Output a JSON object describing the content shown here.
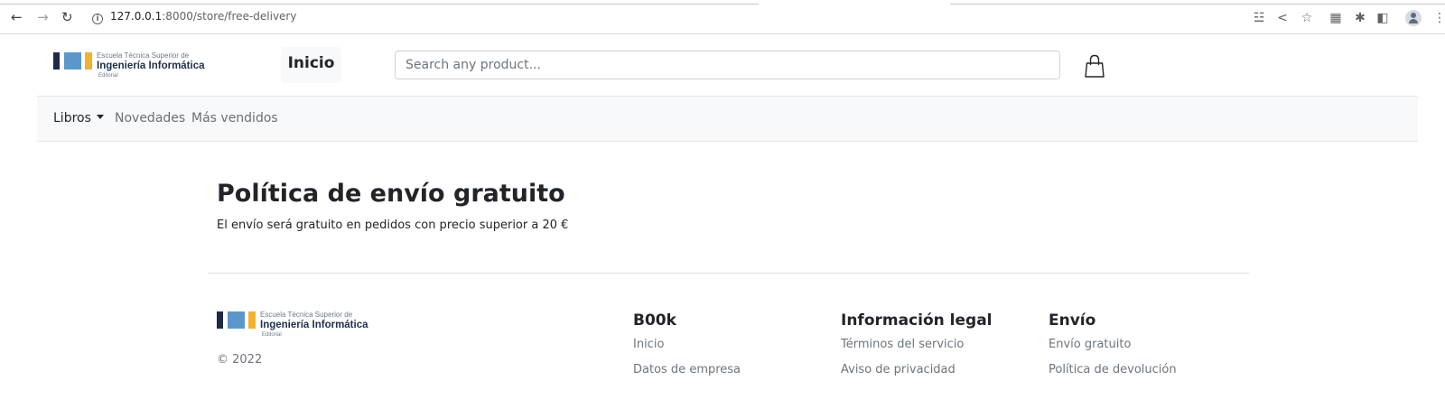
{
  "browser": {
    "url_host": "127.0.0.1",
    "url_path": ":8000/store/free-delivery",
    "info_glyph": "i"
  },
  "logo": {
    "line1": "Escuela Técnica Superior de",
    "line2": "Ingeniería Informática",
    "line3": "Editorial",
    "colors": [
      "#1d2a48",
      "#5a98cc",
      "#f2b12f"
    ]
  },
  "header": {
    "home_label": "Inicio",
    "search_placeholder": "Search any product...",
    "cart_icon": "shopping-bag-icon"
  },
  "navbar": {
    "items": [
      {
        "label": "Libros",
        "dropdown": true
      },
      {
        "label": "Novedades"
      },
      {
        "label": "Más vendidos"
      }
    ]
  },
  "main": {
    "title": "Política de envío gratuito",
    "text": "El envío será gratuito en pedidos con precio superior a 20 €"
  },
  "footer": {
    "copyright": "© 2022",
    "columns": [
      {
        "title": "B00k",
        "links": [
          "Inicio",
          "Datos de empresa"
        ]
      },
      {
        "title": "Información legal",
        "links": [
          "Términos del servicio",
          "Aviso de privacidad"
        ]
      },
      {
        "title": "Envío",
        "links": [
          "Envío gratuito",
          "Política de devolución"
        ]
      }
    ]
  }
}
